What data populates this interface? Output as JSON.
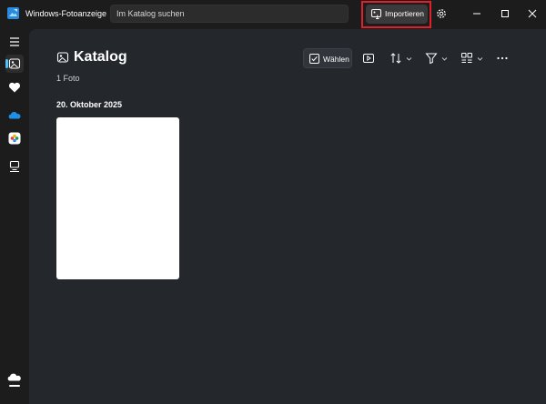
{
  "app": {
    "title": "Windows-Fotoanzeige"
  },
  "search": {
    "placeholder": "Im Katalog suchen"
  },
  "toolbar": {
    "import_label": "Importieren"
  },
  "page": {
    "title": "Katalog",
    "photo_count": "1 Foto",
    "select_label": "Wählen"
  },
  "gallery": {
    "date_header": "20. Oktober 2025"
  },
  "colors": {
    "accent": "#4cc2ff",
    "highlight": "#e0202a",
    "background": "#1c1c1c",
    "content": "#24272c"
  },
  "icons": [
    "app-icon",
    "import-icon",
    "gear-icon",
    "minimize-icon",
    "maximize-icon",
    "close-icon",
    "hamburger-icon",
    "gallery-icon",
    "heart-icon",
    "onedrive-icon",
    "icloud-icon",
    "folders-icon",
    "cloud-icon",
    "slideshow-icon",
    "sort-icon",
    "filter-icon",
    "view-icon",
    "more-icon"
  ]
}
